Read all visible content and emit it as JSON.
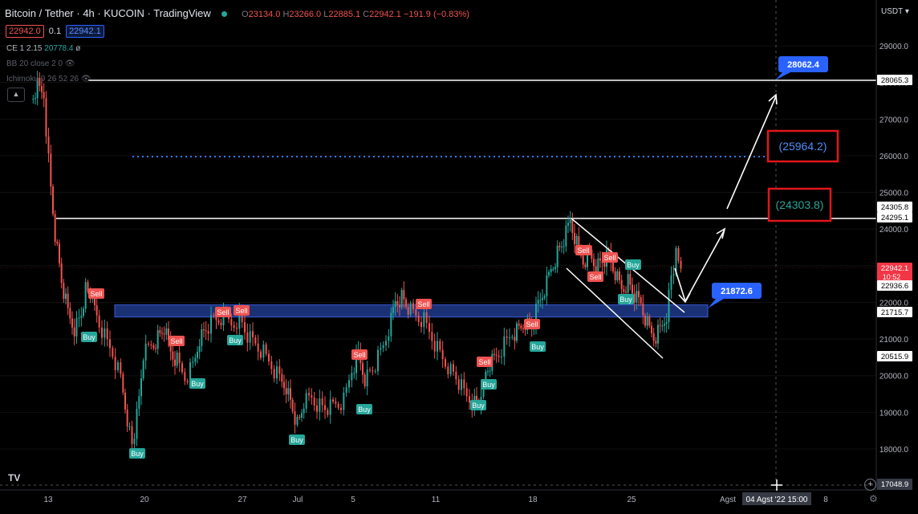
{
  "header": {
    "symbol": "Bitcoin / Tether",
    "interval": "4h",
    "exchange": "KUCOIN",
    "platform": "TradingView",
    "ohlc": {
      "o_label": "O",
      "o": "23134.0",
      "h_label": "H",
      "h": "23266.0",
      "l_label": "L",
      "l": "22885.1",
      "c_label": "C",
      "c": "22942.1",
      "change": "−191.9 (−0.83%)"
    }
  },
  "order": {
    "sell_price": "22942.0",
    "spread": "0.1",
    "buy_price": "22942.1"
  },
  "indicators": [
    {
      "label": "CE 1 2.15",
      "value": "20778.4",
      "suffix": "ø"
    },
    {
      "label": "BB 20 close 2 0",
      "value": "",
      "suffix": "👁"
    },
    {
      "label": "Ichimoku 9 26 52 26",
      "value": "",
      "suffix": "👁"
    }
  ],
  "currency": "USDT",
  "chart_data": {
    "type": "candlestick",
    "y_axis_ticks": [
      29000,
      28000,
      27000,
      26000,
      25000,
      24000,
      23000,
      22000,
      21000,
      20000,
      19000,
      18000
    ],
    "y_axis_labels": [
      "29000.0",
      "28000.0",
      "27000.0",
      "26000.0",
      "25000.0",
      "24000.0",
      "23000.0",
      "22000.0",
      "21000.0",
      "20000.0",
      "19000.0",
      "18000.0"
    ],
    "ylim": [
      16900,
      29300
    ],
    "x_axis_labels": [
      "13",
      "20",
      "27",
      "Jul",
      "5",
      "11",
      "18",
      "25",
      "Agst",
      "8"
    ],
    "crosshair_label": "04 Agst '22  15:00",
    "crosshair_price": "17048.9",
    "price_tags": [
      {
        "value": "28065.3",
        "style": "white"
      },
      {
        "value": "24305.8",
        "style": "white"
      },
      {
        "value": "24295.1",
        "style": "white"
      },
      {
        "value": "22942.1",
        "style": "red",
        "extra": "10:52"
      },
      {
        "value": "22936.6",
        "style": "white"
      },
      {
        "value": "21715.7",
        "style": "white"
      },
      {
        "value": "20515.9",
        "style": "white"
      }
    ],
    "horizontal_lines": [
      {
        "price": 28065.3,
        "style": "solid-white"
      },
      {
        "price": 24305.8,
        "style": "solid-white"
      },
      {
        "price": 25964.2,
        "style": "dotted-blue"
      }
    ],
    "zone": {
      "from": 21600,
      "to": 21930,
      "color": "#1e3a8a"
    },
    "annotations": [
      {
        "text": "28062.4",
        "style": "blue-callout"
      },
      {
        "text": "21872.6",
        "style": "blue-callout"
      },
      {
        "text": "(25964.2)",
        "style": "red-box"
      },
      {
        "text": "(24303.8)",
        "style": "red-box"
      }
    ],
    "signals": [
      {
        "text": "Sell",
        "type": "sell"
      },
      {
        "text": "Buy",
        "type": "buy"
      },
      {
        "text": "Buy",
        "type": "buy"
      },
      {
        "text": "Sell",
        "type": "sell"
      },
      {
        "text": "Buy",
        "type": "buy"
      },
      {
        "text": "Sell",
        "type": "sell"
      },
      {
        "text": "Sell",
        "type": "sell"
      },
      {
        "text": "Buy",
        "type": "buy"
      },
      {
        "text": "Buy",
        "type": "buy"
      },
      {
        "text": "Sell",
        "type": "sell"
      },
      {
        "text": "Buy",
        "type": "buy"
      },
      {
        "text": "Sell",
        "type": "sell"
      },
      {
        "text": "Sell",
        "type": "sell"
      },
      {
        "text": "Buy",
        "type": "buy"
      },
      {
        "text": "Buy",
        "type": "buy"
      },
      {
        "text": "Sell",
        "type": "sell"
      },
      {
        "text": "Buy",
        "type": "buy"
      },
      {
        "text": "Sell",
        "type": "sell"
      },
      {
        "text": "Sell",
        "type": "sell"
      },
      {
        "text": "Sell",
        "type": "sell"
      },
      {
        "text": "Buy",
        "type": "buy"
      },
      {
        "text": "Buy",
        "type": "buy"
      }
    ],
    "colors": {
      "up": "#26a69a",
      "down": "#ef5350",
      "blue": "#2962ff"
    }
  },
  "logo": "TV"
}
